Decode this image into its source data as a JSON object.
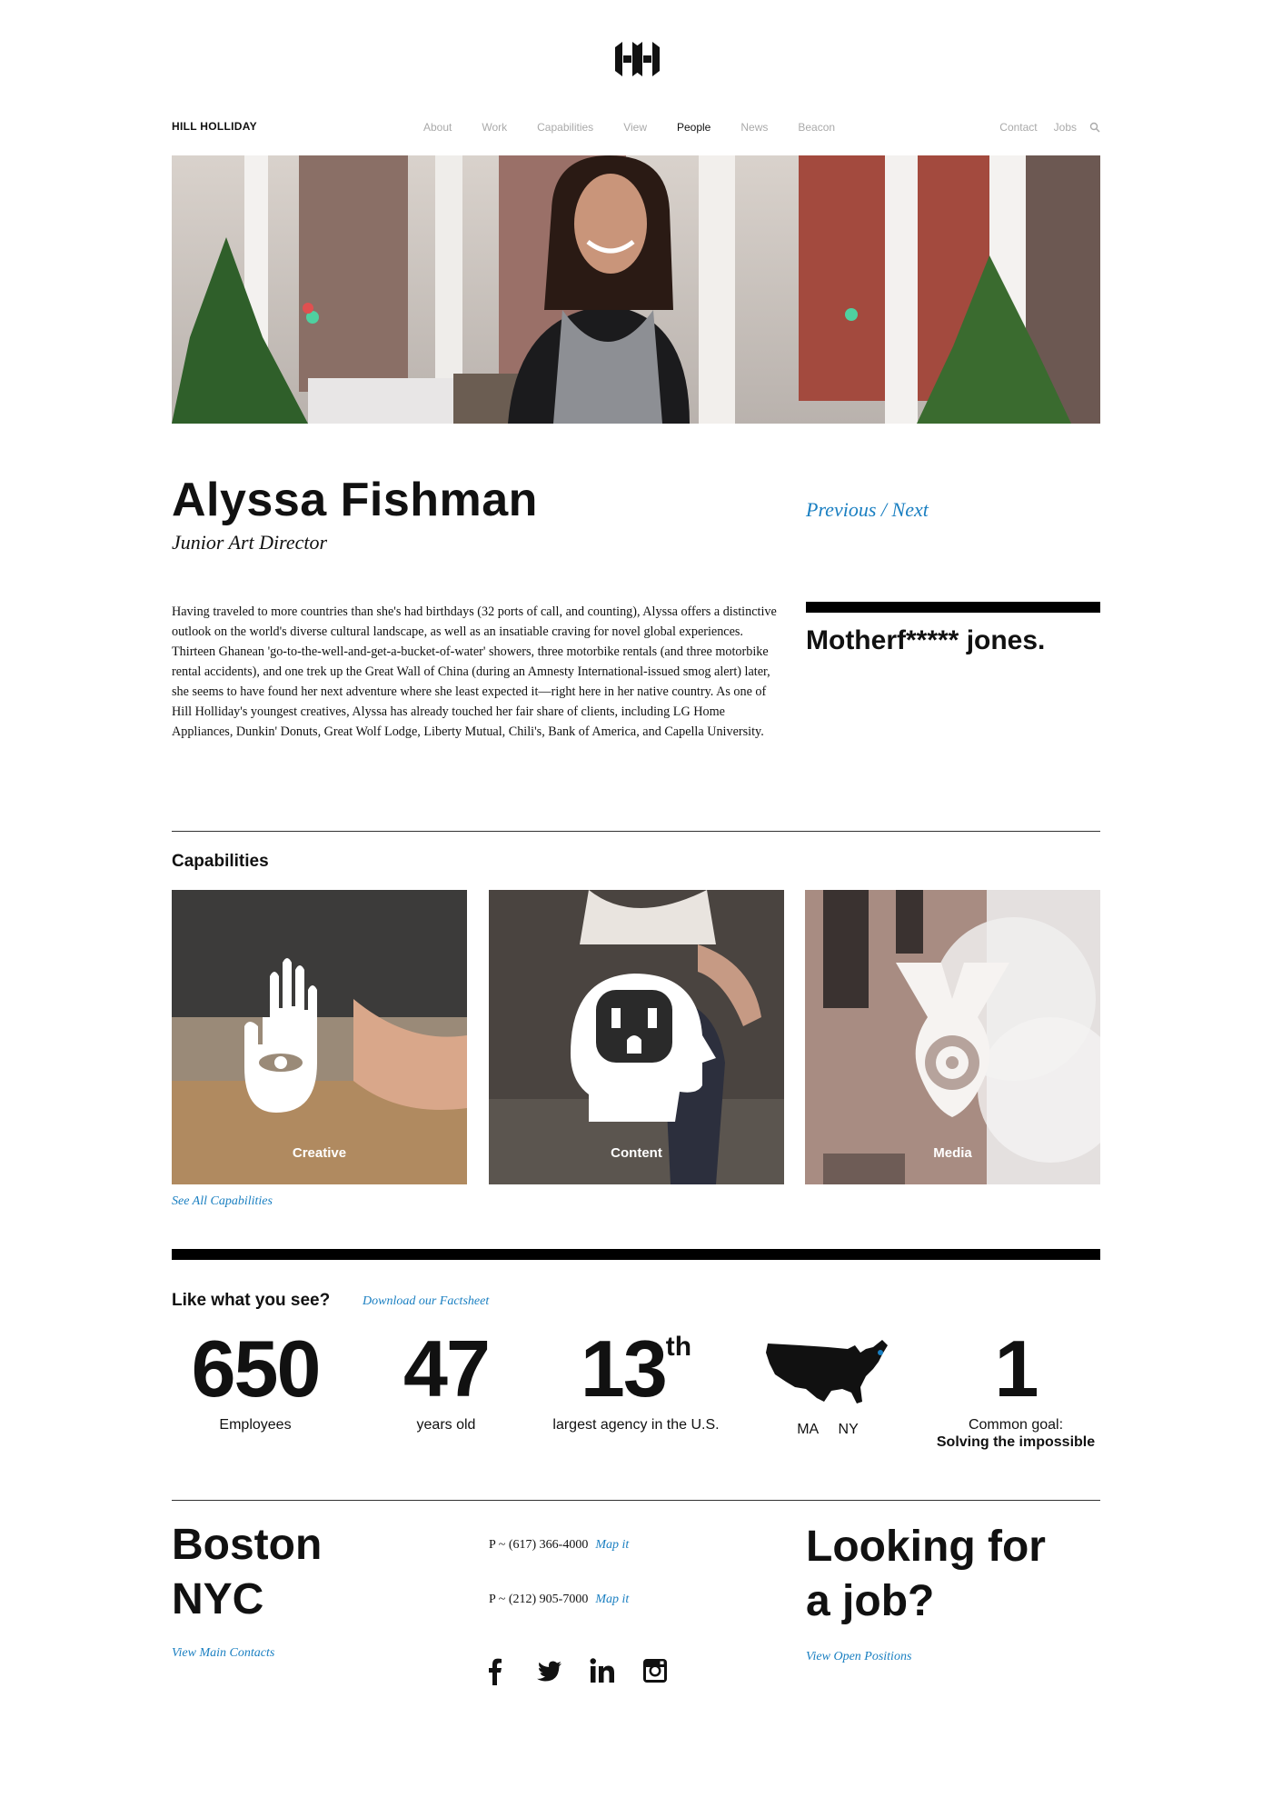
{
  "header": {
    "brand": "HILL HOLLIDAY",
    "nav": [
      "About",
      "Work",
      "Capabilities",
      "View",
      "People",
      "News",
      "Beacon"
    ],
    "nav_active": "People",
    "nav_right": [
      "Contact",
      "Jobs"
    ]
  },
  "person": {
    "name": "Alyssa Fishman",
    "title": "Junior Art Director",
    "previous_label": "Previous",
    "separator": " / ",
    "next_label": "Next",
    "bio": "Having traveled to more countries than she's had birthdays (32 ports of call, and counting), Alyssa offers a distinctive outlook on the world's diverse cultural landscape, as well as an insatiable craving for novel global experiences. Thirteen Ghanean 'go-to-the-well-and-get-a-bucket-of-water' showers, three motorbike rentals (and three motorbike rental accidents), and one trek up the Great Wall of China (during an Amnesty International-issued smog alert) later, she seems to have found her next adventure where she least expected it—right here in her native country. As one of Hill Holliday's youngest creatives, Alyssa has already touched her fair share of clients, including LG Home Appliances, Dunkin' Donuts, Great Wolf Lodge, Liberty Mutual, Chili's, Bank of America, and Capella University.",
    "quote": "Motherf***** jones."
  },
  "capabilities": {
    "heading": "Capabilities",
    "tiles": [
      {
        "label": "Creative",
        "icon": "hand-eye-icon"
      },
      {
        "label": "Content",
        "icon": "head-outlet-icon"
      },
      {
        "label": "Media",
        "icon": "target-drop-icon"
      }
    ],
    "see_all": "See All Capabilities"
  },
  "facts": {
    "heading": "Like what you see?",
    "download": "Download our Factsheet",
    "employees_num": "650",
    "employees_lbl": "Employees",
    "years_num": "47",
    "years_lbl": "years old",
    "rank_num": "13",
    "rank_sup": "th",
    "rank_lbl": "largest agency in the U.S.",
    "map_lbl": "MA     NY",
    "goal_num": "1",
    "goal_lbl": "Common goal:",
    "goal_bold": "Solving the impossible"
  },
  "footer": {
    "city1": "Boston",
    "city2": "NYC",
    "phone1": "P ~ (617) 366-4000",
    "phone2": "P ~ (212) 905-7000",
    "map_it": "Map it",
    "view_contacts": "View Main Contacts",
    "job_line1": "Looking for",
    "job_line2": "a job?",
    "view_positions": "View Open Positions"
  },
  "colors": {
    "link": "#1a7fc1",
    "nav_inactive": "#aaaaaa",
    "text": "#111111"
  }
}
